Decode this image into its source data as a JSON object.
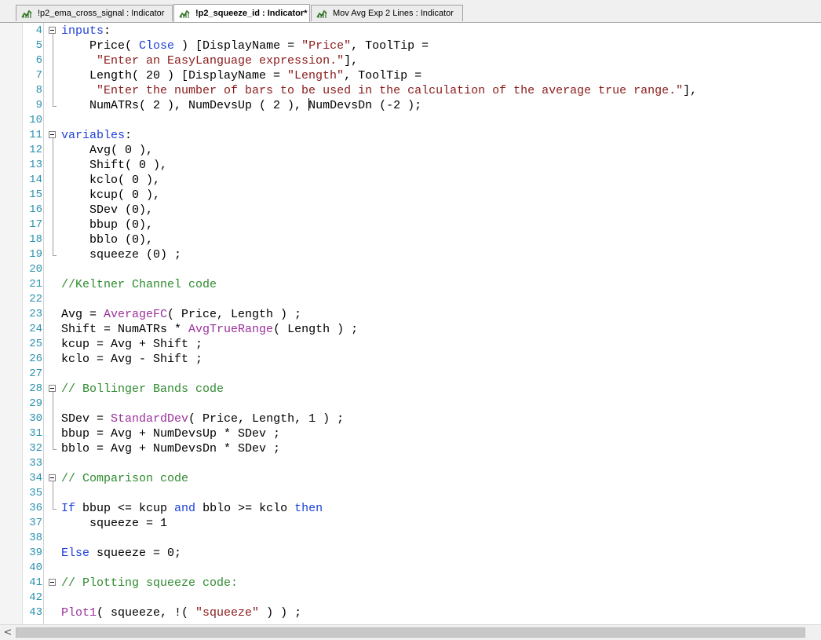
{
  "tabs": [
    {
      "label": "!p2_ema_cross_signal : Indicator",
      "active": false
    },
    {
      "label": "!p2_squeeze_id : Indicator",
      "modified": "*",
      "active": true
    },
    {
      "label": "Mov Avg Exp 2 Lines : Indicator",
      "active": false
    }
  ],
  "colors": {
    "keyword": "#1e40d8",
    "string": "#8b1a1a",
    "comment": "#2e8b2e",
    "function": "#9b309b",
    "number": "#000000",
    "line_number": "#2b91af",
    "plain": "#000000"
  },
  "icons": {
    "tab_icon": "indicator-chart-icon",
    "scroll_left": "chevron-left-icon"
  },
  "scroll_left_glyph": "<",
  "editor": {
    "lines": [
      {
        "n": "4",
        "fold": true,
        "tokens": [
          [
            "k",
            "inputs"
          ],
          [
            "p",
            ":"
          ]
        ]
      },
      {
        "n": "5",
        "tokens": [
          [
            "p",
            "    Price( "
          ],
          [
            "k",
            "Close"
          ],
          [
            "p",
            " ) [DisplayName = "
          ],
          [
            "s",
            "\"Price\""
          ],
          [
            "p",
            ", ToolTip ="
          ]
        ]
      },
      {
        "n": "6",
        "tokens": [
          [
            "p",
            "     "
          ],
          [
            "s",
            "\"Enter an EasyLanguage expression.\""
          ],
          [
            "p",
            "],"
          ]
        ]
      },
      {
        "n": "7",
        "tokens": [
          [
            "p",
            "    Length( 20 ) [DisplayName = "
          ],
          [
            "s",
            "\"Length\""
          ],
          [
            "p",
            ", ToolTip ="
          ]
        ]
      },
      {
        "n": "8",
        "tokens": [
          [
            "p",
            "     "
          ],
          [
            "s",
            "\"Enter the number of bars to be used in the calculation of the average true range.\""
          ],
          [
            "p",
            "],"
          ]
        ]
      },
      {
        "n": "9",
        "tokens": [
          [
            "p",
            "    NumATRs( 2 ), NumDevsUp ( 2 ), "
          ],
          [
            "caret",
            ""
          ],
          [
            "p",
            "NumDevsDn (-2 );"
          ]
        ]
      },
      {
        "n": "10",
        "tokens": []
      },
      {
        "n": "11",
        "fold": true,
        "tokens": [
          [
            "k",
            "variables"
          ],
          [
            "p",
            ":"
          ]
        ]
      },
      {
        "n": "12",
        "tokens": [
          [
            "p",
            "    Avg( 0 ),"
          ]
        ]
      },
      {
        "n": "13",
        "tokens": [
          [
            "p",
            "    Shift( 0 ),"
          ]
        ]
      },
      {
        "n": "14",
        "tokens": [
          [
            "p",
            "    kclo( 0 ),"
          ]
        ]
      },
      {
        "n": "15",
        "tokens": [
          [
            "p",
            "    kcup( 0 ),"
          ]
        ]
      },
      {
        "n": "16",
        "tokens": [
          [
            "p",
            "    SDev (0),"
          ]
        ]
      },
      {
        "n": "17",
        "tokens": [
          [
            "p",
            "    bbup (0),"
          ]
        ]
      },
      {
        "n": "18",
        "tokens": [
          [
            "p",
            "    bblo (0),"
          ]
        ]
      },
      {
        "n": "19",
        "tokens": [
          [
            "p",
            "    squeeze (0) ;"
          ]
        ]
      },
      {
        "n": "20",
        "tokens": []
      },
      {
        "n": "21",
        "tokens": [
          [
            "c",
            "//Keltner Channel code"
          ]
        ]
      },
      {
        "n": "22",
        "tokens": []
      },
      {
        "n": "23",
        "tokens": [
          [
            "p",
            "Avg = "
          ],
          [
            "f",
            "AverageFC"
          ],
          [
            "p",
            "( Price, Length ) ;"
          ]
        ]
      },
      {
        "n": "24",
        "tokens": [
          [
            "p",
            "Shift = NumATRs * "
          ],
          [
            "f",
            "AvgTrueRange"
          ],
          [
            "p",
            "( Length ) ;"
          ]
        ]
      },
      {
        "n": "25",
        "tokens": [
          [
            "p",
            "kcup = Avg + Shift ;"
          ]
        ]
      },
      {
        "n": "26",
        "tokens": [
          [
            "p",
            "kclo = Avg - Shift ;"
          ]
        ]
      },
      {
        "n": "27",
        "tokens": []
      },
      {
        "n": "28",
        "fold": true,
        "tokens": [
          [
            "c",
            "// Bollinger Bands code"
          ]
        ]
      },
      {
        "n": "29",
        "tokens": []
      },
      {
        "n": "30",
        "tokens": [
          [
            "p",
            "SDev = "
          ],
          [
            "f",
            "StandardDev"
          ],
          [
            "p",
            "( Price, Length, 1 ) ;"
          ]
        ]
      },
      {
        "n": "31",
        "tokens": [
          [
            "p",
            "bbup = Avg + NumDevsUp * SDev ;"
          ]
        ]
      },
      {
        "n": "32",
        "tokens": [
          [
            "p",
            "bblo = Avg + NumDevsDn * SDev ;"
          ]
        ]
      },
      {
        "n": "33",
        "tokens": []
      },
      {
        "n": "34",
        "fold": true,
        "tokens": [
          [
            "c",
            "// Comparison code"
          ]
        ]
      },
      {
        "n": "35",
        "tokens": []
      },
      {
        "n": "36",
        "tokens": [
          [
            "k",
            "If"
          ],
          [
            "p",
            " bbup <= kcup "
          ],
          [
            "k",
            "and"
          ],
          [
            "p",
            " bblo >= kclo "
          ],
          [
            "k",
            "then"
          ]
        ]
      },
      {
        "n": "37",
        "tokens": [
          [
            "p",
            "    squeeze = 1"
          ]
        ]
      },
      {
        "n": "38",
        "tokens": []
      },
      {
        "n": "39",
        "tokens": [
          [
            "k",
            "Else"
          ],
          [
            "p",
            " squeeze = 0;"
          ]
        ]
      },
      {
        "n": "40",
        "tokens": []
      },
      {
        "n": "41",
        "fold": true,
        "tokens": [
          [
            "c",
            "// Plotting squeeze code:"
          ]
        ]
      },
      {
        "n": "42",
        "tokens": []
      },
      {
        "n": "43",
        "tokens": [
          [
            "f",
            "Plot1"
          ],
          [
            "p",
            "( squeeze, !( "
          ],
          [
            "s",
            "\"squeeze\""
          ],
          [
            "p",
            " ) ) ;"
          ]
        ]
      }
    ]
  }
}
